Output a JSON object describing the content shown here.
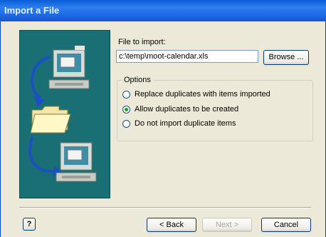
{
  "window": {
    "title": "Import a File"
  },
  "file": {
    "label": "File to import:",
    "value": "c:\\temp\\moot-calendar.xls"
  },
  "buttons": {
    "browse": "Browse ...",
    "back": "< Back",
    "next": "Next >",
    "cancel": "Cancel",
    "help": "?"
  },
  "options": {
    "title": "Options",
    "items": [
      {
        "label": "Replace duplicates with items imported",
        "selected": false
      },
      {
        "label": "Allow duplicates to be created",
        "selected": true
      },
      {
        "label": "Do not import duplicate items",
        "selected": false
      }
    ]
  }
}
